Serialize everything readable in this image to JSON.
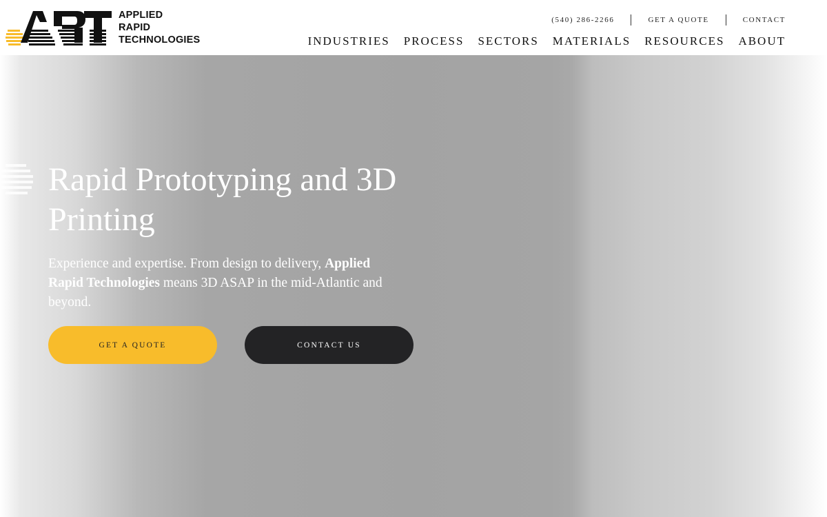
{
  "brand": {
    "monogram": "ART",
    "name_lines": [
      "APPLIED",
      "RAPID",
      "TECHNOLOGIES"
    ],
    "accent_color": "#f8bc2b"
  },
  "utility_nav": {
    "phone": "(540) 286-2266",
    "quote": "GET A QUOTE",
    "contact": "CONTACT"
  },
  "main_nav": {
    "items": [
      "INDUSTRIES",
      "PROCESS",
      "SECTORS",
      "MATERIALS",
      "RESOURCES",
      "ABOUT"
    ]
  },
  "hero": {
    "title": "Rapid Prototyping and 3D Printing",
    "subtitle_lead": "Experience and expertise. From design to delivery, ",
    "subtitle_brand": "Applied Rapid Technologies",
    "subtitle_tail": " means 3D ASAP in the mid-Atlantic and beyond.",
    "primary_button": "GET A QUOTE",
    "secondary_button": "CONTACT US",
    "primary_button_color": "#f8bc2b",
    "secondary_button_color": "#232325"
  }
}
